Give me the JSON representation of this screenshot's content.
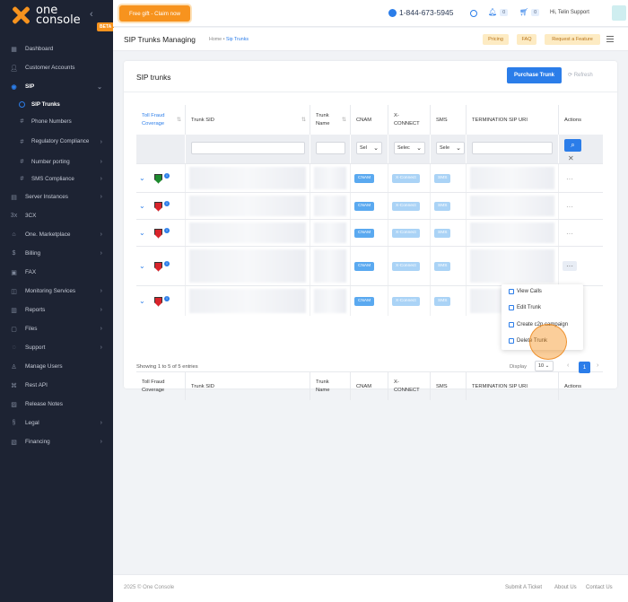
{
  "brand": {
    "logo_text": "one\nconsole",
    "beta": "BETA"
  },
  "sidebar": {
    "items": [
      {
        "label": "Dashboard",
        "icon": "grid-icon"
      },
      {
        "label": "Customer Accounts",
        "icon": "users-icon"
      },
      {
        "label": "SIP",
        "icon": "sip-icon",
        "active": true
      },
      {
        "label": "SIP Trunks",
        "sub": true,
        "on": true
      },
      {
        "label": "Phone Numbers",
        "sub": true
      },
      {
        "label": "Regulatory Compliance",
        "sub": true
      },
      {
        "label": "Number porting",
        "sub": true
      },
      {
        "label": "SMS Compliance",
        "sub": true
      },
      {
        "label": "Server Instances",
        "icon": "server-icon"
      },
      {
        "label": "3CX",
        "icon": "3cx-icon"
      },
      {
        "label": "One. Marketplace",
        "icon": "store-icon"
      },
      {
        "label": "Billing",
        "icon": "dollar-icon"
      },
      {
        "label": "FAX",
        "icon": "fax-icon"
      },
      {
        "label": "Monitoring Services",
        "icon": "monitor-icon"
      },
      {
        "label": "Reports",
        "icon": "reports-icon"
      },
      {
        "label": "Files",
        "icon": "files-icon"
      },
      {
        "label": "Support",
        "icon": "support-icon"
      },
      {
        "label": "Manage Users",
        "icon": "user-icon"
      },
      {
        "label": "Rest API",
        "icon": "api-icon"
      },
      {
        "label": "Release Notes",
        "icon": "notes-icon"
      },
      {
        "label": "Legal",
        "icon": "legal-icon"
      },
      {
        "label": "Financing",
        "icon": "financing-icon"
      }
    ]
  },
  "topbar": {
    "gift": "Free gift - Claim now",
    "phone": "1-844-673-5945",
    "notif_count": "0",
    "cart_count": "0",
    "greeting": "Hi, Telin Support"
  },
  "subbar": {
    "title": "SIP Trunks Managing",
    "crumb_home": "Home",
    "crumb_sep": "•",
    "crumb_current": "Sip Trunks",
    "pricing": "Pricing",
    "faq": "FAQ",
    "request": "Request a Feature"
  },
  "card": {
    "title": "SIP trunks",
    "purchase": "Purchase Trunk",
    "refresh": "Refresh"
  },
  "table": {
    "headers": [
      "Toll Fraud Coverage",
      "Trunk SID",
      "Trunk Name",
      "CNAM",
      "X-CONNECT",
      "SMS",
      "TERMINATION SIP URI",
      "Actions"
    ],
    "filters": {
      "cnam": "Sel",
      "xconnect": "Selec",
      "sms": "Sele"
    },
    "rows": [
      {
        "shield": "green",
        "cnam": "CNAM",
        "xconnect": "X-Connect",
        "sms": "SMS"
      },
      {
        "shield": "red",
        "cnam": "CNAM",
        "xconnect": "X-Connect",
        "sms": "SMS"
      },
      {
        "shield": "red",
        "cnam": "CNAM",
        "xconnect": "X-Connect",
        "sms": "SMS"
      },
      {
        "shield": "red",
        "cnam": "CNAM",
        "xconnect": "X-Connect",
        "sms": "SMS"
      },
      {
        "shield": "red",
        "cnam": "CNAM",
        "xconnect": "X-Connect",
        "sms": "SMS"
      }
    ],
    "footer": [
      "Toll Fraud Coverage",
      "Trunk SID",
      "Trunk Name",
      "CNAM",
      "X-CONNECT",
      "SMS",
      "TERMINATION SIP URI",
      "Actions"
    ],
    "showing": "Showing 1 to 5 of 5 entries",
    "display_label": "Display",
    "display_value": "10",
    "page": "1"
  },
  "menu": {
    "items": [
      "View Calls",
      "Edit Trunk",
      "Create c2p campaign",
      "Delete Trunk"
    ]
  },
  "footer": {
    "copyright": "2025 © One Console",
    "links": [
      "Submit A Ticket",
      "About Us",
      "Contact Us"
    ]
  }
}
